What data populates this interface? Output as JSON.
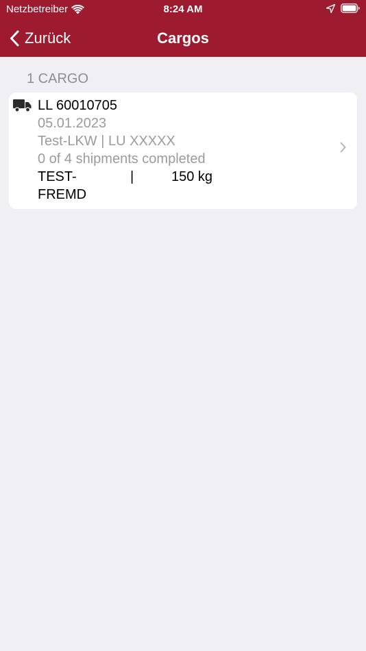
{
  "status_bar": {
    "carrier": "Netzbetreiber",
    "time": "8:24 AM"
  },
  "nav": {
    "back_label": "Zurück",
    "title": "Cargos"
  },
  "section_header": "1 CARGO",
  "cargo": {
    "id": "LL 60010705",
    "date": "05.01.2023",
    "vehicle_info": "Test-LKW | LU XXXXX",
    "progress_text": "0 of 4 shipments completed",
    "vehicle_name": "TEST-FREMD",
    "separator": "|",
    "weight": "150 kg"
  },
  "colors": {
    "brand": "#9e1a2e",
    "background": "#efeff4",
    "secondary_text": "#9b9b9b"
  }
}
